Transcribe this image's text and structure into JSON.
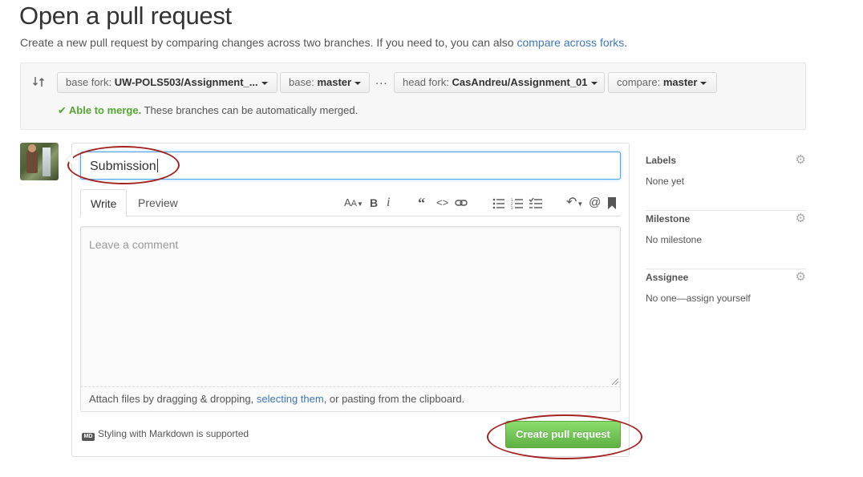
{
  "page": {
    "title": "Open a pull request",
    "subtitle_prefix": "Create a new pull request by comparing changes across two branches. If you need to, you can also ",
    "subtitle_link": "compare across forks",
    "subtitle_suffix": "."
  },
  "compare": {
    "base_fork_label": "base fork:",
    "base_fork_value": "UW-POLS503/Assignment_...",
    "base_label": "base:",
    "base_value": "master",
    "dots": "...",
    "head_fork_label": "head fork:",
    "head_fork_value": "CasAndreu/Assignment_01",
    "compare_label": "compare:",
    "compare_value": "master",
    "merge_ok": "Able to merge.",
    "merge_text": " These branches can be automatically merged."
  },
  "form": {
    "title_value": "Submission",
    "tabs": [
      {
        "label": "Write",
        "active": true
      },
      {
        "label": "Preview",
        "active": false
      }
    ],
    "toolbar": [
      {
        "icon": "text-size-icon",
        "glyph": "AA▾"
      },
      {
        "icon": "bold-icon",
        "glyph": "B"
      },
      {
        "icon": "italic-icon",
        "glyph": "i"
      },
      {
        "icon": "quote-icon",
        "glyph": "❝"
      },
      {
        "icon": "code-icon",
        "glyph": "<>"
      },
      {
        "icon": "link-icon",
        "glyph": "⊘"
      },
      {
        "icon": "unordered-list-icon",
        "glyph": "☰"
      },
      {
        "icon": "ordered-list-icon",
        "glyph": "☰"
      },
      {
        "icon": "task-list-icon",
        "glyph": "☰"
      },
      {
        "icon": "reply-icon",
        "glyph": "↶▾"
      },
      {
        "icon": "mention-icon",
        "glyph": "@"
      },
      {
        "icon": "bookmark-icon",
        "glyph": "▮"
      }
    ],
    "comment_placeholder": "Leave a comment",
    "attach_prefix": "Attach files by dragging & dropping, ",
    "attach_link": "selecting them",
    "attach_suffix": ", or pasting from the clipboard.",
    "markdown_icon": "MD",
    "markdown_note": "Styling with Markdown is supported",
    "submit_label": "Create pull request"
  },
  "sidebar": {
    "sections": [
      {
        "title": "Labels",
        "value": "None yet"
      },
      {
        "title": "Milestone",
        "value": "No milestone"
      },
      {
        "title": "Assignee",
        "value": "No one—assign yourself"
      }
    ]
  },
  "colors": {
    "link": "#4078c0",
    "success": "#55a532",
    "annotation_circle": "#a3241f",
    "primary_button": "#60b044"
  }
}
